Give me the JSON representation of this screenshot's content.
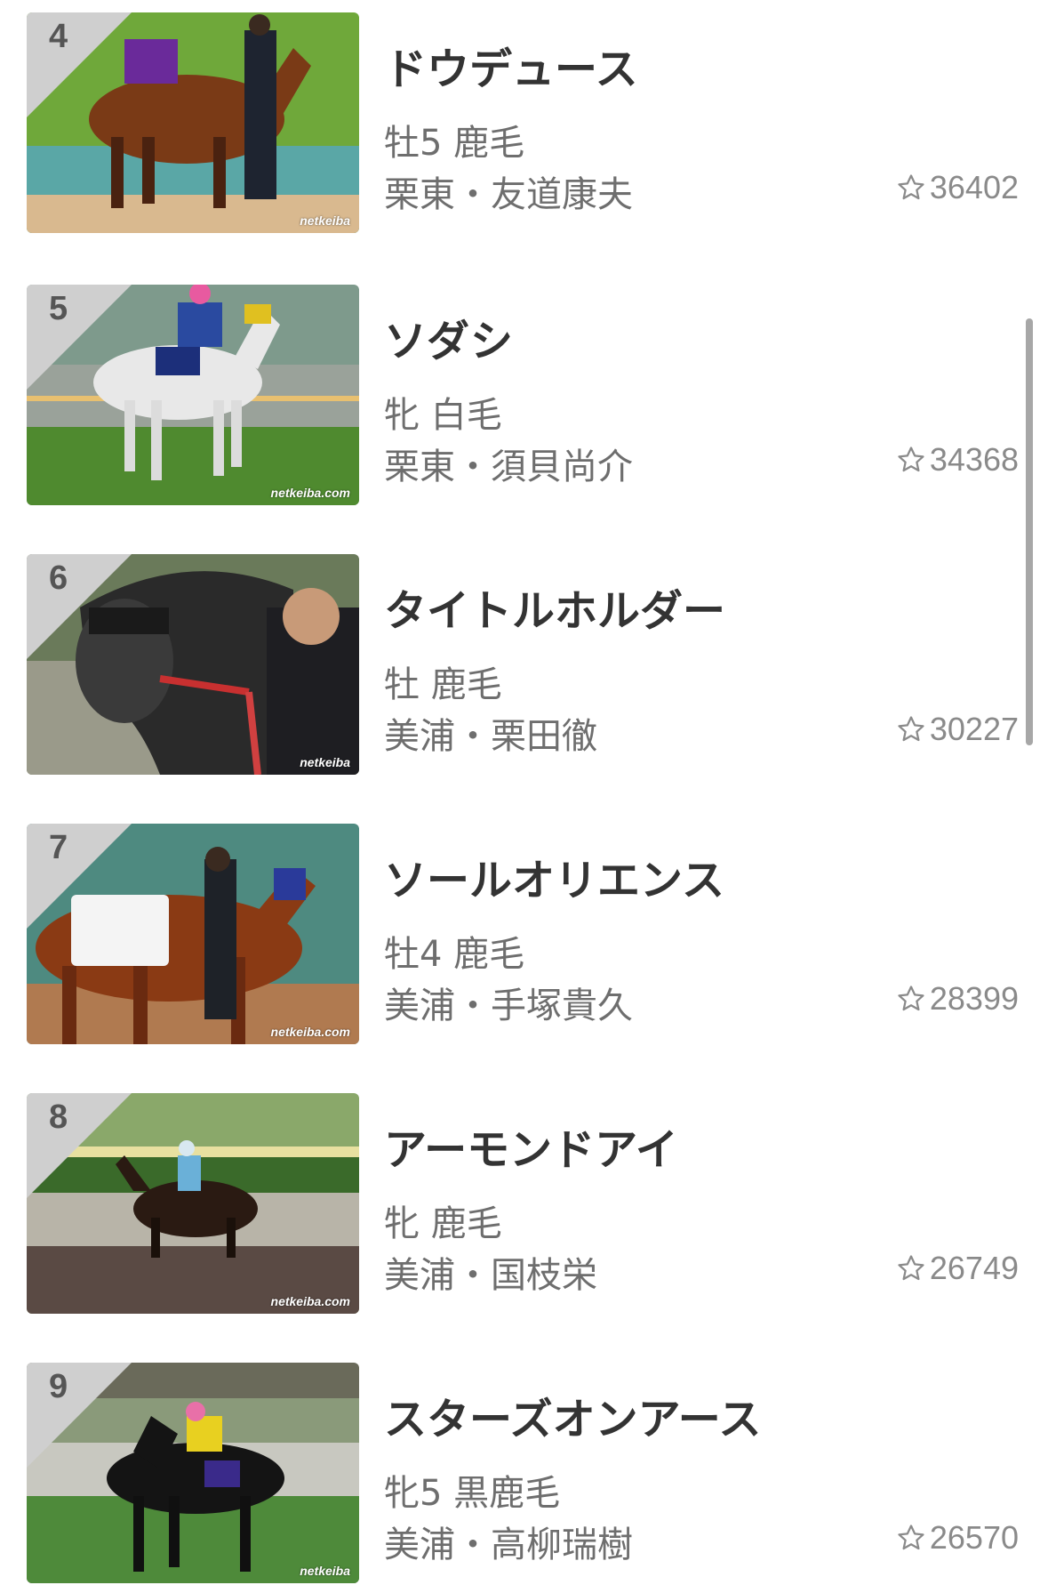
{
  "horses": [
    {
      "rank": "4",
      "name": "ドウデュース",
      "meta": "牡5 鹿毛",
      "stable": "栗東・友道康夫",
      "favorites": "36402",
      "watermark": "netkeiba"
    },
    {
      "rank": "5",
      "name": "ソダシ",
      "meta": "牝 白毛",
      "stable": "栗東・須貝尚介",
      "favorites": "34368",
      "watermark": "netkeiba.com"
    },
    {
      "rank": "6",
      "name": "タイトルホルダー",
      "meta": "牡 鹿毛",
      "stable": "美浦・栗田徹",
      "favorites": "30227",
      "watermark": "netkeiba"
    },
    {
      "rank": "7",
      "name": "ソールオリエンス",
      "meta": "牡4 鹿毛",
      "stable": "美浦・手塚貴久",
      "favorites": "28399",
      "watermark": "netkeiba.com"
    },
    {
      "rank": "8",
      "name": "アーモンドアイ",
      "meta": "牝 鹿毛",
      "stable": "美浦・国枝栄",
      "favorites": "26749",
      "watermark": "netkeiba.com"
    },
    {
      "rank": "9",
      "name": "スターズオンアース",
      "meta": "牝5 黒鹿毛",
      "stable": "美浦・高柳瑞樹",
      "favorites": "26570",
      "watermark": "netkeiba"
    }
  ],
  "icons": {
    "favorite": "star-outline-icon",
    "photo": "horse-photo"
  },
  "colors": {
    "text_primary": "#333333",
    "text_secondary": "#6e6e6e",
    "count": "#8a8a8a",
    "rank_badge": "#cfcfcf"
  }
}
